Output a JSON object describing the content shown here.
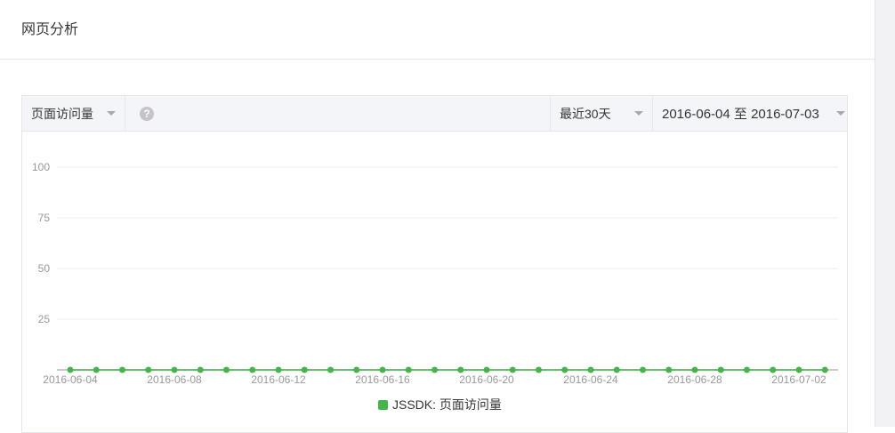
{
  "page": {
    "title": "网页分析"
  },
  "toolbar": {
    "metric_label": "页面访问量",
    "help_icon": "question-circle-icon",
    "range_label": "最近30天",
    "date_range_label": "2016-06-04 至 2016-07-03"
  },
  "colors": {
    "series": "#44b549",
    "grid": "#ececec",
    "axis": "#b8b8b8",
    "tick_text": "#999999"
  },
  "chart_data": {
    "type": "line",
    "ylim": [
      0,
      100
    ],
    "yticks": [
      25,
      50,
      75,
      100
    ],
    "xtick_labels": [
      "2016-06-04",
      "2016-06-08",
      "2016-06-12",
      "2016-06-16",
      "2016-06-20",
      "2016-06-24",
      "2016-06-28",
      "2016-07-02"
    ],
    "x": [
      "2016-06-04",
      "2016-06-05",
      "2016-06-06",
      "2016-06-07",
      "2016-06-08",
      "2016-06-09",
      "2016-06-10",
      "2016-06-11",
      "2016-06-12",
      "2016-06-13",
      "2016-06-14",
      "2016-06-15",
      "2016-06-16",
      "2016-06-17",
      "2016-06-18",
      "2016-06-19",
      "2016-06-20",
      "2016-06-21",
      "2016-06-22",
      "2016-06-23",
      "2016-06-24",
      "2016-06-25",
      "2016-06-26",
      "2016-06-27",
      "2016-06-28",
      "2016-06-29",
      "2016-06-30",
      "2016-07-01",
      "2016-07-02",
      "2016-07-03"
    ],
    "series": [
      {
        "name": "JSSDK: 页面访问量",
        "values": [
          0,
          0,
          0,
          0,
          0,
          0,
          0,
          0,
          0,
          0,
          0,
          0,
          0,
          0,
          0,
          0,
          0,
          0,
          0,
          0,
          0,
          0,
          0,
          0,
          0,
          0,
          0,
          0,
          0,
          0
        ]
      }
    ],
    "legend": "bottom-center",
    "grid": true
  }
}
